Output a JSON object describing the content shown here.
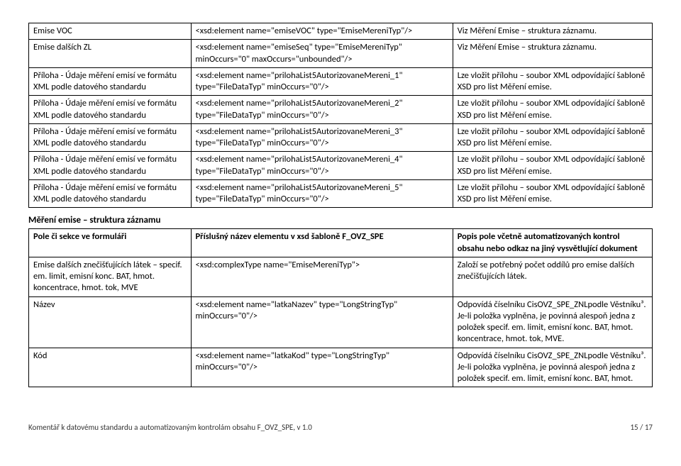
{
  "table1": {
    "rows": [
      {
        "c1": "Emise VOC",
        "c2": "<xsd:element name=\"emiseVOC\" type=\"EmiseMereniTyp\"/>",
        "c3": "Viz Měření Emise – struktura záznamu."
      },
      {
        "c1": "Emise dalších ZL",
        "c2": "<xsd:element name=\"emiseSeq\" type=\"EmiseMereniTyp\" minOccurs=\"0\" maxOccurs=\"unbounded\"/>",
        "c3": "Viz Měření Emise – struktura záznamu."
      },
      {
        "c1": "Příloha - Údaje měření emisí ve formátu XML podle datového standardu",
        "c2": "<xsd:element name=\"prilohaList5AutorizovaneMereni_1\" type=\"FileDataTyp\" minOccurs=\"0\"/>",
        "c3": "Lze vložit přílohu – soubor XML odpovídající šabloně XSD pro list Měření emise."
      },
      {
        "c1": "Příloha - Údaje měření emisí ve formátu XML podle datového standardu",
        "c2": "<xsd:element name=\"prilohaList5AutorizovaneMereni_2\" type=\"FileDataTyp\" minOccurs=\"0\"/>",
        "c3": "Lze vložit přílohu – soubor XML odpovídající šabloně XSD pro list Měření emise."
      },
      {
        "c1": "Příloha - Údaje měření emisí ve formátu XML podle datového standardu",
        "c2": "<xsd:element name=\"prilohaList5AutorizovaneMereni_3\" type=\"FileDataTyp\" minOccurs=\"0\"/>",
        "c3": "Lze vložit přílohu – soubor XML odpovídající šabloně XSD pro list Měření emise."
      },
      {
        "c1": "Příloha - Údaje měření emisí ve formátu XML podle datového standardu",
        "c2": "<xsd:element name=\"prilohaList5AutorizovaneMereni_4\" type=\"FileDataTyp\" minOccurs=\"0\"/>",
        "c3": "Lze vložit přílohu – soubor XML odpovídající šabloně XSD pro list Měření emise."
      },
      {
        "c1": "Příloha - Údaje měření emisí ve formátu XML podle datového standardu",
        "c2": "<xsd:element name=\"prilohaList5AutorizovaneMereni_5\" type=\"FileDataTyp\" minOccurs=\"0\"/>",
        "c3": "Lze vložit přílohu – soubor XML odpovídající šabloně XSD pro list Měření emise."
      }
    ]
  },
  "section2_title": "Měření emise – struktura záznamu",
  "table2": {
    "headers": {
      "h1": "Pole či sekce ve formuláři",
      "h2": "Příslušný název elementu v xsd šabloně F_OVZ_SPE",
      "h3": "Popis pole včetně automatizovaných kontrol obsahu nebo odkaz na jiný vysvětlující dokument"
    },
    "rows": [
      {
        "c1": "Emise dalších znečišťujících látek – specif. em. limit, emisní konc. BAT, hmot. koncentrace, hmot. tok, MVE",
        "c2": "<xsd:complexType name=\"EmiseMereniTyp\">",
        "c3": "Založí se potřebný počet oddílů pro emise dalších znečišťujících látek."
      },
      {
        "c1": "Název",
        "c2": "<xsd:element name=\"latkaNazev\" type=\"LongStringTyp\" minOccurs=\"0\"/>",
        "c3": "Odpovídá číselníku CisOVZ_SPE_ZNLpodle Věstníku³. Je-li položka vyplněna, je povinná alespoň jedna z položek specif. em. limit, emisní konc. BAT, hmot. koncentrace, hmot. tok, MVE."
      },
      {
        "c1": "Kód",
        "c2": "<xsd:element name=\"latkaKod\" type=\"LongStringTyp\" minOccurs=\"0\"/>",
        "c3": "Odpovídá číselníku CisOVZ_SPE_ZNLpodle Věstníku³. Je-li položka vyplněna, je povinná alespoň jedna z položek specif. em. limit, emisní konc. BAT, hmot."
      }
    ]
  },
  "footer": {
    "left": "Komentář k datovému standardu a automatizovaným kontrolám obsahu  F_OVZ_SPE, v 1.0",
    "right": "15 / 17"
  }
}
